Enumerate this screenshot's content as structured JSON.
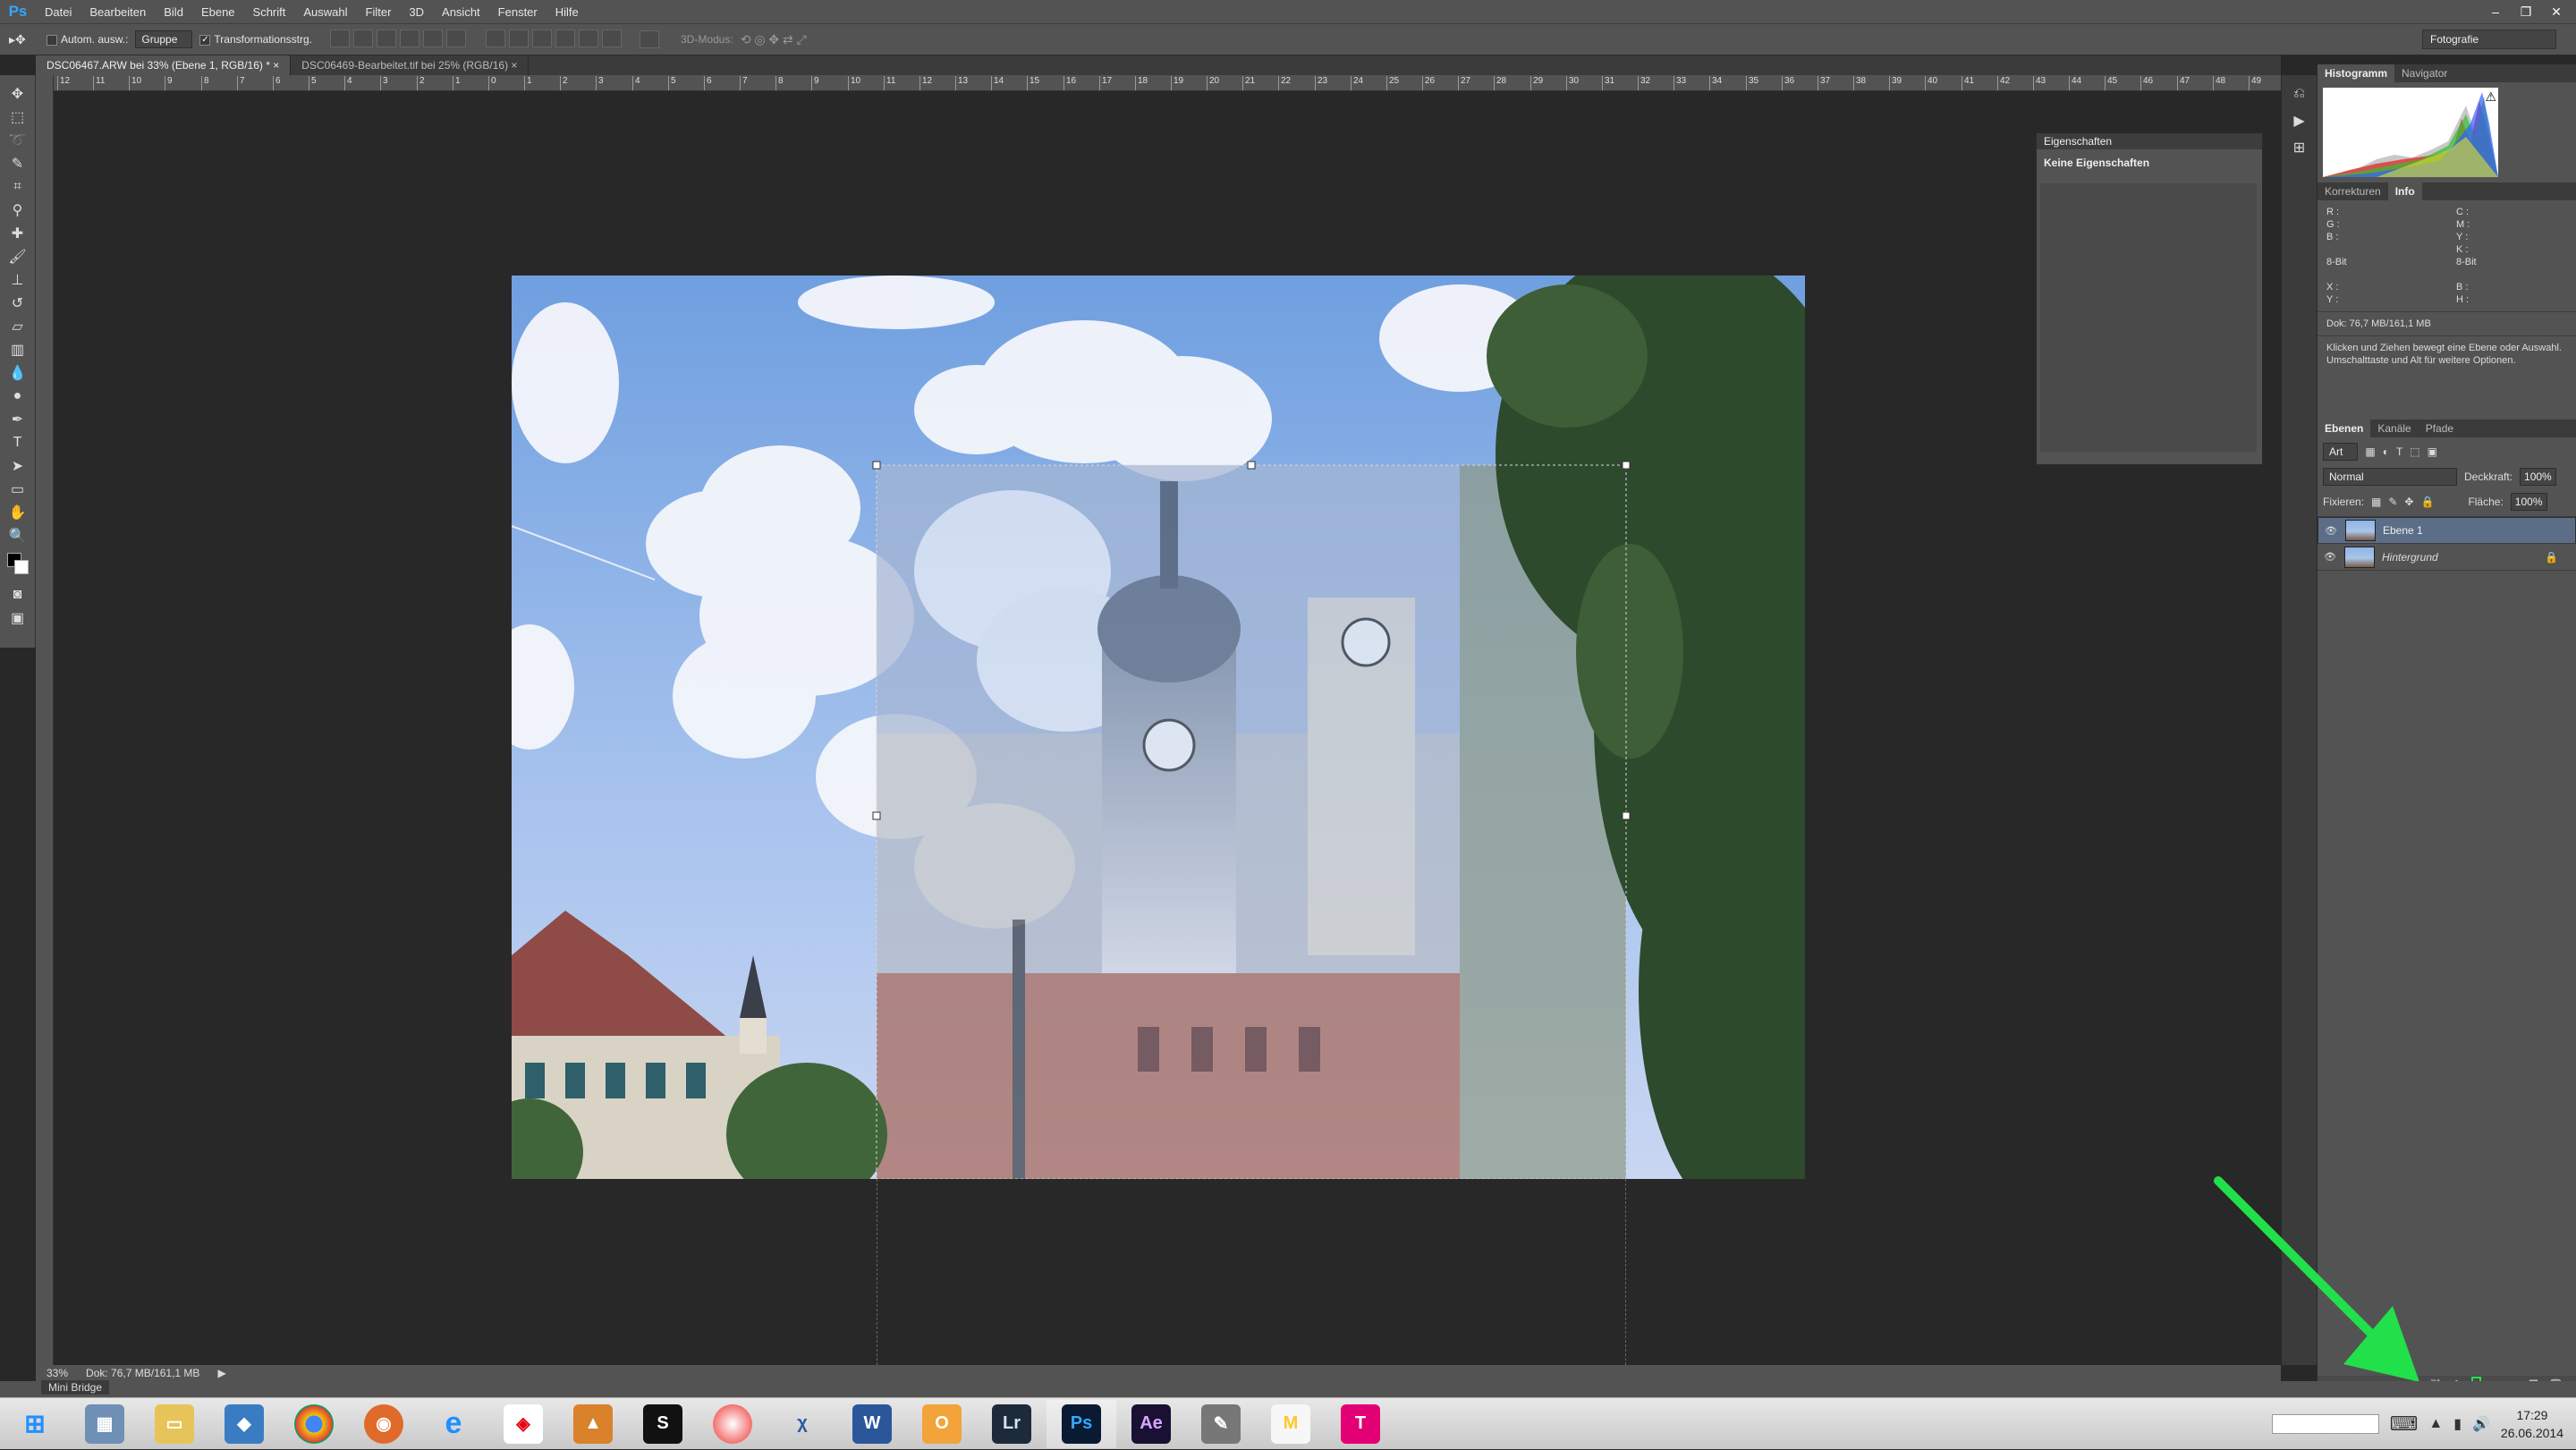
{
  "app": {
    "logo": "Ps"
  },
  "menu": [
    "Datei",
    "Bearbeiten",
    "Bild",
    "Ebene",
    "Schrift",
    "Auswahl",
    "Filter",
    "3D",
    "Ansicht",
    "Fenster",
    "Hilfe"
  ],
  "window_controls": [
    "–",
    "❐",
    "✕"
  ],
  "options": {
    "auto_select_label": "Autom. ausw.:",
    "group_value": "Gruppe",
    "transform_label": "Transformationsstrg.",
    "mode_3d_label": "3D-Modus:"
  },
  "workspace": "Fotografie",
  "doc_tabs": [
    {
      "label": "DSC06467.ARW bei 33% (Ebene 1, RGB/16) *",
      "active": true
    },
    {
      "label": "DSC06469-Bearbeitet.tif bei 25% (RGB/16)",
      "active": false
    }
  ],
  "ruler_ticks": [
    "12",
    "11",
    "10",
    "9",
    "8",
    "7",
    "6",
    "5",
    "4",
    "3",
    "2",
    "1",
    "0",
    "1",
    "2",
    "3",
    "4",
    "5",
    "6",
    "7",
    "8",
    "9",
    "10",
    "11",
    "12",
    "13",
    "14",
    "15",
    "16",
    "17",
    "18",
    "19",
    "20",
    "21",
    "22",
    "23",
    "24",
    "25",
    "26",
    "27",
    "28",
    "29",
    "30",
    "31",
    "32",
    "33",
    "34",
    "35",
    "36",
    "37",
    "38",
    "39",
    "40",
    "41",
    "42",
    "43",
    "44",
    "45",
    "46",
    "47",
    "48",
    "49"
  ],
  "properties": {
    "title": "Eigenschaften",
    "empty_text": "Keine Eigenschaften"
  },
  "right_panel": {
    "tabs_top": [
      "Histogramm",
      "Navigator"
    ],
    "tabs_info": [
      "Korrekturen",
      "Info"
    ],
    "info_left": [
      "R :",
      "G :",
      "B :",
      "",
      "8-Bit",
      "",
      "X :",
      "Y :"
    ],
    "info_right": [
      "C :",
      "M :",
      "Y :",
      "K :",
      "8-Bit",
      "",
      "B :",
      "H :"
    ],
    "doc_size": "Dok: 76,7 MB/161,1 MB",
    "hint": "Klicken und Ziehen bewegt eine Ebene oder Auswahl. Umschalttaste und Alt für weitere Optionen.",
    "layer_tabs": [
      "Ebenen",
      "Kanäle",
      "Pfade"
    ],
    "kind_filter": "Art",
    "blend_mode": "Normal",
    "opacity_label": "Deckkraft:",
    "opacity_value": "100%",
    "lock_label": "Fixieren:",
    "fill_label": "Fläche:",
    "fill_value": "100%",
    "layers": [
      {
        "name": "Ebene 1",
        "selected": true
      },
      {
        "name": "Hintergrund",
        "selected": false
      }
    ],
    "fx_label": "fx"
  },
  "status": {
    "zoom": "33%",
    "doc": "Dok: 76,7 MB/161,1 MB"
  },
  "mini_bridge": "Mini Bridge",
  "taskbar": {
    "apps": [
      "Lr",
      "Ps",
      "Ae",
      "M",
      "T"
    ],
    "time": "17:29",
    "date": "26.06.2014"
  },
  "colors": {
    "arrow": "#22e04a",
    "selected_layer": "#5c6e87",
    "ps_blue": "#31a8ff"
  }
}
